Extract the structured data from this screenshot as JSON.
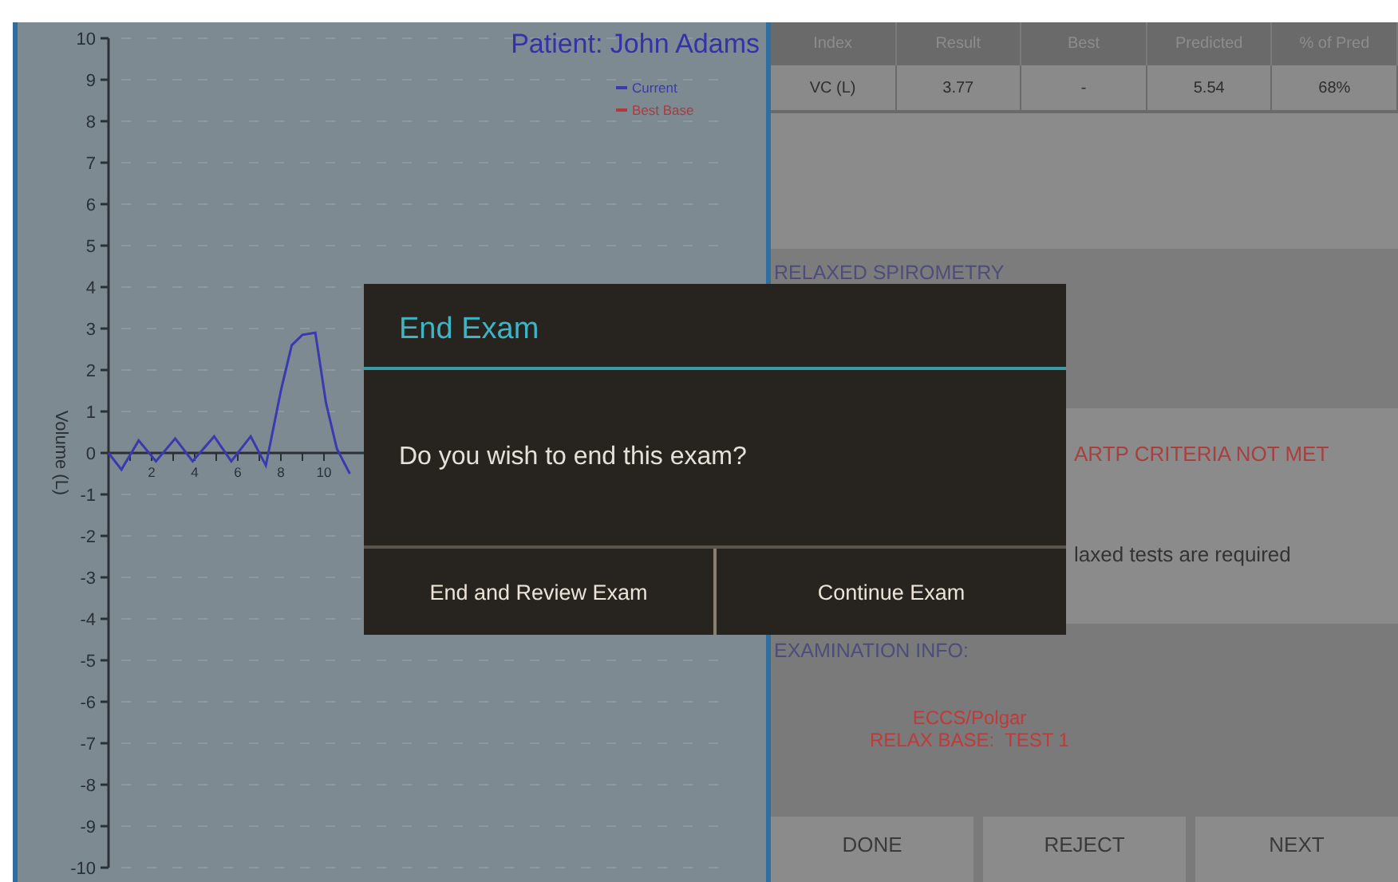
{
  "chart_panel": {
    "title": "Patient: John Adams",
    "legend": [
      {
        "label": "Best Base",
        "color": "#b03a3a"
      }
    ],
    "chart_data": {
      "type": "line",
      "ylabel": "Volume (L)",
      "ylim": [
        -10,
        10
      ],
      "xlim": [
        0,
        12
      ],
      "grid": true,
      "yticks": [
        -10,
        -9,
        -8,
        -7,
        -6,
        -5,
        -4,
        -3,
        -2,
        -1,
        0,
        1,
        2,
        3,
        4,
        5,
        6,
        7,
        8,
        9,
        10
      ],
      "xticks": [
        2,
        4,
        6,
        8,
        10
      ],
      "x": [
        0,
        0.6,
        1.4,
        2.2,
        3.1,
        3.9,
        4.9,
        5.7,
        6.6,
        7.3,
        8,
        8.5,
        9,
        9.6,
        10.1,
        10.6,
        11.2
      ],
      "series": [
        {
          "name": "Current",
          "color": "#3a3ab0",
          "values": [
            0,
            -0.4,
            0.3,
            -0.2,
            0.35,
            -0.2,
            0.4,
            -0.2,
            0.4,
            -0.3,
            1.5,
            2.6,
            2.85,
            2.9,
            1.2,
            0.1,
            -0.5
          ]
        }
      ]
    }
  },
  "results_table": {
    "columns": [
      "Index",
      "Result",
      "Best",
      "Predicted",
      "% of Pred"
    ],
    "rows": [
      [
        "VC (L)",
        "3.77",
        "-",
        "5.54",
        "68%"
      ]
    ]
  },
  "relaxed_spirometry": {
    "heading": "RELAXED SPIROMETRY"
  },
  "criteria": {
    "lines": [
      {
        "text": "ARTP CRITERIA NOT MET",
        "kind": "alert"
      },
      {
        "text": "laxed tests are required",
        "kind": "note"
      }
    ]
  },
  "examination_info": {
    "heading": "EXAMINATION INFO:",
    "lines": [
      "ECCS/Polgar",
      "RELAX BASE:  TEST 1"
    ]
  },
  "buttons": [
    "DONE",
    "REJECT",
    "NEXT"
  ],
  "dialog": {
    "title": "End Exam",
    "message": "Do you wish to end this exam?",
    "buttons": [
      "End and Review Exam",
      "Continue Exam"
    ]
  }
}
